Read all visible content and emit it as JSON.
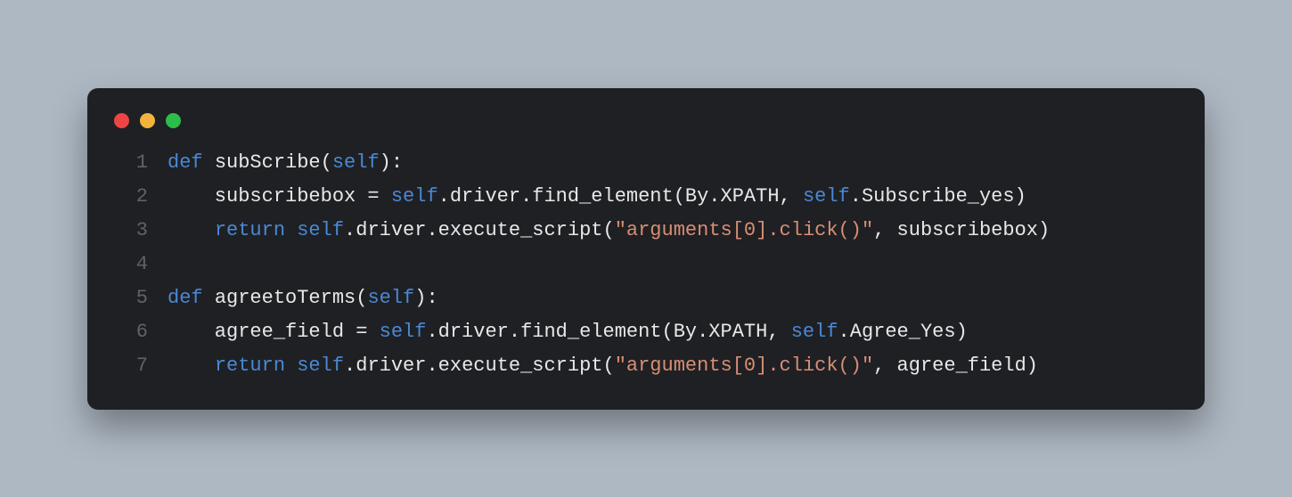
{
  "window": {
    "dot_colors": {
      "close": "#ef4444",
      "minimize": "#f2b43c",
      "zoom": "#2cbd4a"
    }
  },
  "code": {
    "lines": [
      {
        "n": "1",
        "tokens": [
          {
            "cls": "tok-kw",
            "t": "def"
          },
          {
            "cls": "tok-plain",
            "t": " "
          },
          {
            "cls": "tok-fn",
            "t": "subScribe"
          },
          {
            "cls": "tok-punct",
            "t": "("
          },
          {
            "cls": "tok-self",
            "t": "self"
          },
          {
            "cls": "tok-punct",
            "t": "):"
          }
        ]
      },
      {
        "n": "2",
        "tokens": [
          {
            "cls": "tok-plain",
            "t": "    subscribebox = "
          },
          {
            "cls": "tok-self",
            "t": "self"
          },
          {
            "cls": "tok-plain",
            "t": ".driver.find_element(By.XPATH, "
          },
          {
            "cls": "tok-self",
            "t": "self"
          },
          {
            "cls": "tok-plain",
            "t": ".Subscribe_yes)"
          }
        ]
      },
      {
        "n": "3",
        "tokens": [
          {
            "cls": "tok-plain",
            "t": "    "
          },
          {
            "cls": "tok-kw",
            "t": "return"
          },
          {
            "cls": "tok-plain",
            "t": " "
          },
          {
            "cls": "tok-self",
            "t": "self"
          },
          {
            "cls": "tok-plain",
            "t": ".driver.execute_script("
          },
          {
            "cls": "tok-str",
            "t": "\"arguments[0].click()\""
          },
          {
            "cls": "tok-plain",
            "t": ", subscribebox)"
          }
        ]
      },
      {
        "n": "4",
        "tokens": [
          {
            "cls": "tok-plain",
            "t": ""
          }
        ]
      },
      {
        "n": "5",
        "tokens": [
          {
            "cls": "tok-kw",
            "t": "def"
          },
          {
            "cls": "tok-plain",
            "t": " "
          },
          {
            "cls": "tok-fn",
            "t": "agreetoTerms"
          },
          {
            "cls": "tok-punct",
            "t": "("
          },
          {
            "cls": "tok-self",
            "t": "self"
          },
          {
            "cls": "tok-punct",
            "t": "):"
          }
        ]
      },
      {
        "n": "6",
        "tokens": [
          {
            "cls": "tok-plain",
            "t": "    agree_field = "
          },
          {
            "cls": "tok-self",
            "t": "self"
          },
          {
            "cls": "tok-plain",
            "t": ".driver.find_element(By.XPATH, "
          },
          {
            "cls": "tok-self",
            "t": "self"
          },
          {
            "cls": "tok-plain",
            "t": ".Agree_Yes)"
          }
        ]
      },
      {
        "n": "7",
        "tokens": [
          {
            "cls": "tok-plain",
            "t": "    "
          },
          {
            "cls": "tok-kw",
            "t": "return"
          },
          {
            "cls": "tok-plain",
            "t": " "
          },
          {
            "cls": "tok-self",
            "t": "self"
          },
          {
            "cls": "tok-plain",
            "t": ".driver.execute_script("
          },
          {
            "cls": "tok-str",
            "t": "\"arguments[0].click()\""
          },
          {
            "cls": "tok-plain",
            "t": ", agree_field)"
          }
        ]
      }
    ]
  }
}
